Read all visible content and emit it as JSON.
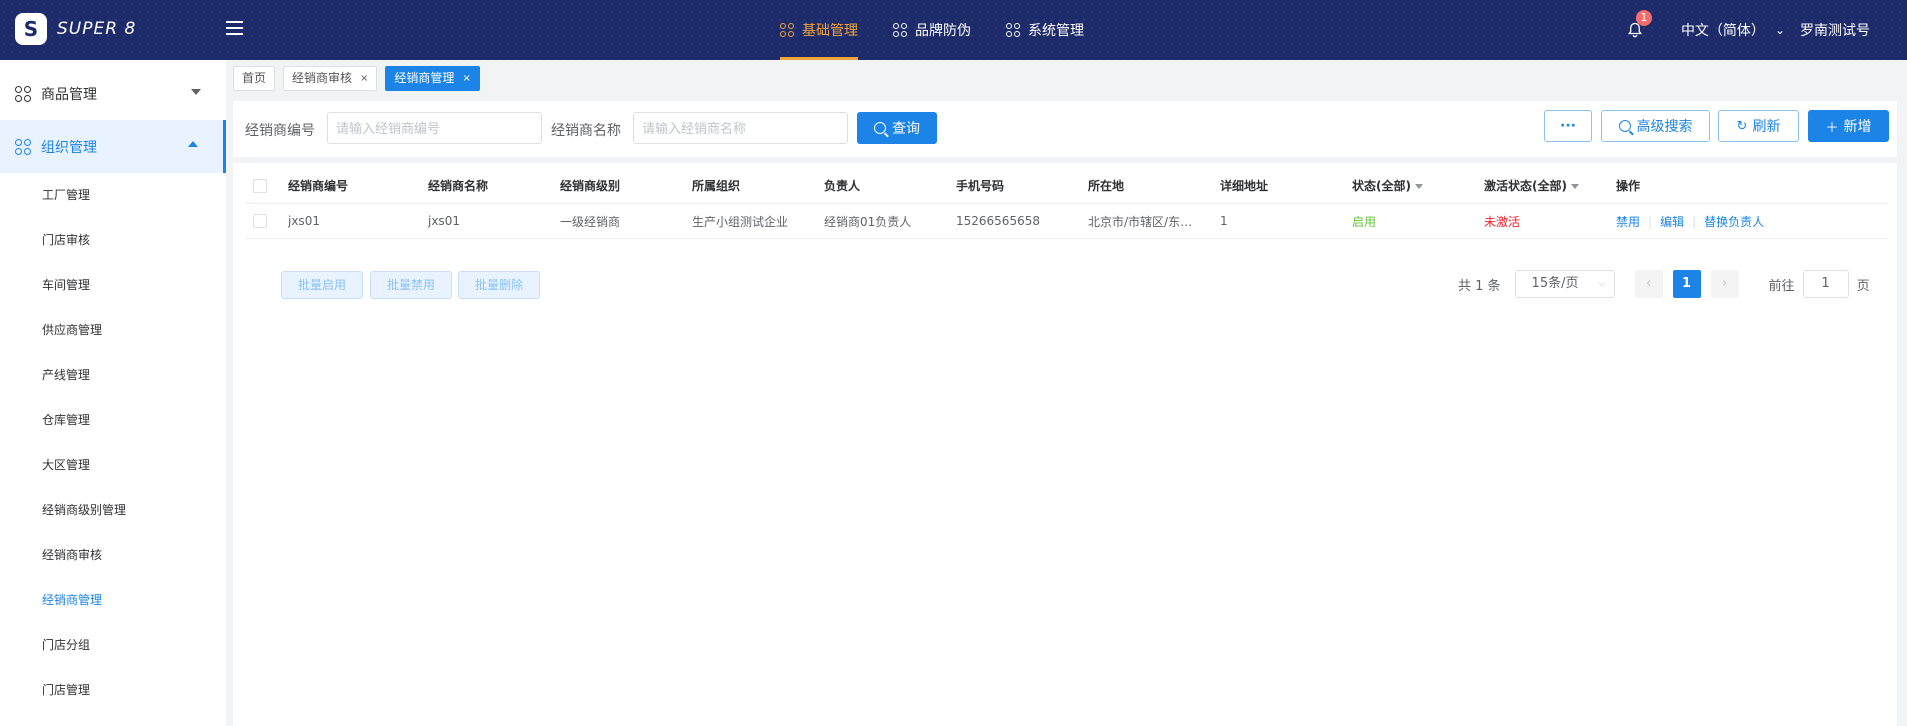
{
  "header": {
    "logo_text": "SUPER 8",
    "nav": [
      {
        "label": "基础管理",
        "active": true
      },
      {
        "label": "品牌防伪",
        "active": false
      },
      {
        "label": "系统管理",
        "active": false
      }
    ],
    "notification_count": "1",
    "language": "中文（简体）",
    "user": "罗南测试号",
    "colors": {
      "header_bg": "#1d2b6b",
      "accent": "#f3a43a",
      "primary": "#1c84e6"
    }
  },
  "sidebar": {
    "groups": [
      {
        "label": "商品管理",
        "expanded": false
      },
      {
        "label": "组织管理",
        "expanded": true
      }
    ],
    "items": [
      "工厂管理",
      "门店审核",
      "车间管理",
      "供应商管理",
      "产线管理",
      "仓库管理",
      "大区管理",
      "经销商级别管理",
      "经销商审核",
      "经销商管理",
      "门店分组",
      "门店管理"
    ],
    "active_item": "经销商管理"
  },
  "tabs": [
    {
      "label": "首页",
      "closable": false
    },
    {
      "label": "经销商审核",
      "closable": true
    },
    {
      "label": "经销商管理",
      "closable": true,
      "active": true
    }
  ],
  "search": {
    "code_label": "经销商编号",
    "code_placeholder": "请输入经销商编号",
    "name_label": "经销商名称",
    "name_placeholder": "请输入经销商名称",
    "query_button": "查询",
    "more_button": "···",
    "advanced_button": "高级搜索",
    "refresh_button": "刷新",
    "add_button": "新增"
  },
  "table": {
    "columns": [
      "经销商编号",
      "经销商名称",
      "经销商级别",
      "所属组织",
      "负责人",
      "手机号码",
      "所在地",
      "详细地址",
      "状态(全部)",
      "激活状态(全部)",
      "操作"
    ],
    "rows": [
      {
        "code": "jxs01",
        "name": "jxs01",
        "level": "一级经销商",
        "org": "生产小组测试企业",
        "owner": "经销商01负责人",
        "phone": "15266565658",
        "location": "北京市/市辖区/东…",
        "address": "1",
        "status": "启用",
        "activation": "未激活",
        "actions": [
          "禁用",
          "编辑",
          "替换负责人"
        ]
      }
    ]
  },
  "batch": {
    "enable": "批量启用",
    "disable": "批量禁用",
    "delete": "批量删除"
  },
  "pagination": {
    "total": "共 1 条",
    "page_size": "15条/页",
    "prev": "‹",
    "current": "1",
    "next": "›",
    "goto_prefix": "前往",
    "goto_value": "1",
    "goto_suffix": "页"
  }
}
